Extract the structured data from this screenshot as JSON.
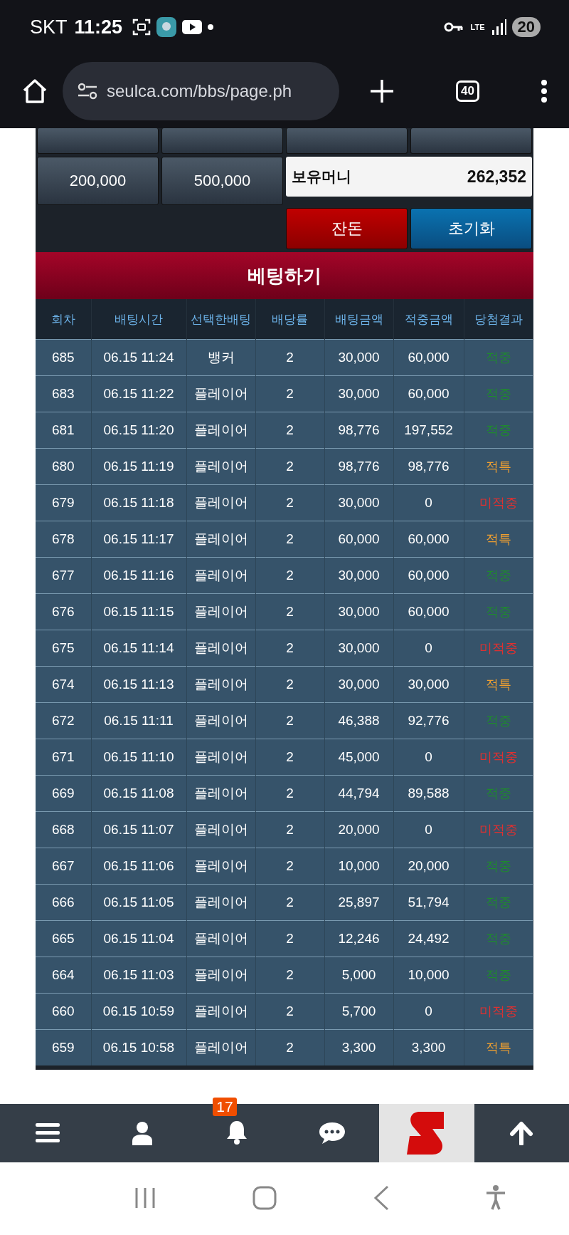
{
  "status_bar": {
    "carrier": "SKT",
    "time": "11:25",
    "network": "LTE",
    "battery": "20"
  },
  "browser": {
    "url": "seulca.com/bbs/page.ph",
    "tab_count": "40"
  },
  "chips": [
    "200,000",
    "500,000"
  ],
  "balance": {
    "label": "보유머니",
    "value": "262,352"
  },
  "actions": [
    {
      "label": "잔돈",
      "kind": "change"
    },
    {
      "label": "초기화",
      "kind": "reset"
    }
  ],
  "banner": "베팅하기",
  "table": {
    "columns": [
      "회차",
      "배팅시간",
      "선택한배팅",
      "배당률",
      "배팅금액",
      "적중금액",
      "당첨결과"
    ],
    "rows": [
      {
        "round": "685",
        "time": "06.15 11:24",
        "pick": "뱅커",
        "odds": "2",
        "bet": "30,000",
        "payout": "60,000",
        "result": "적중",
        "color": "#1f8a2e"
      },
      {
        "round": "683",
        "time": "06.15 11:22",
        "pick": "플레이어",
        "odds": "2",
        "bet": "30,000",
        "payout": "60,000",
        "result": "적중",
        "color": "#1f8a2e"
      },
      {
        "round": "681",
        "time": "06.15 11:20",
        "pick": "플레이어",
        "odds": "2",
        "bet": "98,776",
        "payout": "197,552",
        "result": "적중",
        "color": "#1f8a2e"
      },
      {
        "round": "680",
        "time": "06.15 11:19",
        "pick": "플레이어",
        "odds": "2",
        "bet": "98,776",
        "payout": "98,776",
        "result": "적특",
        "color": "#f0a030"
      },
      {
        "round": "679",
        "time": "06.15 11:18",
        "pick": "플레이어",
        "odds": "2",
        "bet": "30,000",
        "payout": "0",
        "result": "미적중",
        "color": "#e03030"
      },
      {
        "round": "678",
        "time": "06.15 11:17",
        "pick": "플레이어",
        "odds": "2",
        "bet": "60,000",
        "payout": "60,000",
        "result": "적특",
        "color": "#f0a030"
      },
      {
        "round": "677",
        "time": "06.15 11:16",
        "pick": "플레이어",
        "odds": "2",
        "bet": "30,000",
        "payout": "60,000",
        "result": "적중",
        "color": "#1f8a2e"
      },
      {
        "round": "676",
        "time": "06.15 11:15",
        "pick": "플레이어",
        "odds": "2",
        "bet": "30,000",
        "payout": "60,000",
        "result": "적중",
        "color": "#1f8a2e"
      },
      {
        "round": "675",
        "time": "06.15 11:14",
        "pick": "플레이어",
        "odds": "2",
        "bet": "30,000",
        "payout": "0",
        "result": "미적중",
        "color": "#e03030"
      },
      {
        "round": "674",
        "time": "06.15 11:13",
        "pick": "플레이어",
        "odds": "2",
        "bet": "30,000",
        "payout": "30,000",
        "result": "적특",
        "color": "#f0a030"
      },
      {
        "round": "672",
        "time": "06.15 11:11",
        "pick": "플레이어",
        "odds": "2",
        "bet": "46,388",
        "payout": "92,776",
        "result": "적중",
        "color": "#1f8a2e"
      },
      {
        "round": "671",
        "time": "06.15 11:10",
        "pick": "플레이어",
        "odds": "2",
        "bet": "45,000",
        "payout": "0",
        "result": "미적중",
        "color": "#e03030"
      },
      {
        "round": "669",
        "time": "06.15 11:08",
        "pick": "플레이어",
        "odds": "2",
        "bet": "44,794",
        "payout": "89,588",
        "result": "적중",
        "color": "#1f8a2e"
      },
      {
        "round": "668",
        "time": "06.15 11:07",
        "pick": "플레이어",
        "odds": "2",
        "bet": "20,000",
        "payout": "0",
        "result": "미적중",
        "color": "#e03030"
      },
      {
        "round": "667",
        "time": "06.15 11:06",
        "pick": "플레이어",
        "odds": "2",
        "bet": "10,000",
        "payout": "20,000",
        "result": "적중",
        "color": "#1f8a2e"
      },
      {
        "round": "666",
        "time": "06.15 11:05",
        "pick": "플레이어",
        "odds": "2",
        "bet": "25,897",
        "payout": "51,794",
        "result": "적중",
        "color": "#1f8a2e"
      },
      {
        "round": "665",
        "time": "06.15 11:04",
        "pick": "플레이어",
        "odds": "2",
        "bet": "12,246",
        "payout": "24,492",
        "result": "적중",
        "color": "#1f8a2e"
      },
      {
        "round": "664",
        "time": "06.15 11:03",
        "pick": "플레이어",
        "odds": "2",
        "bet": "5,000",
        "payout": "10,000",
        "result": "적중",
        "color": "#1f8a2e"
      },
      {
        "round": "660",
        "time": "06.15 10:59",
        "pick": "플레이어",
        "odds": "2",
        "bet": "5,700",
        "payout": "0",
        "result": "미적중",
        "color": "#e03030"
      },
      {
        "round": "659",
        "time": "06.15 10:58",
        "pick": "플레이어",
        "odds": "2",
        "bet": "3,300",
        "payout": "3,300",
        "result": "적특",
        "color": "#f0a030"
      }
    ]
  },
  "bottom_nav": {
    "badge": "17"
  }
}
